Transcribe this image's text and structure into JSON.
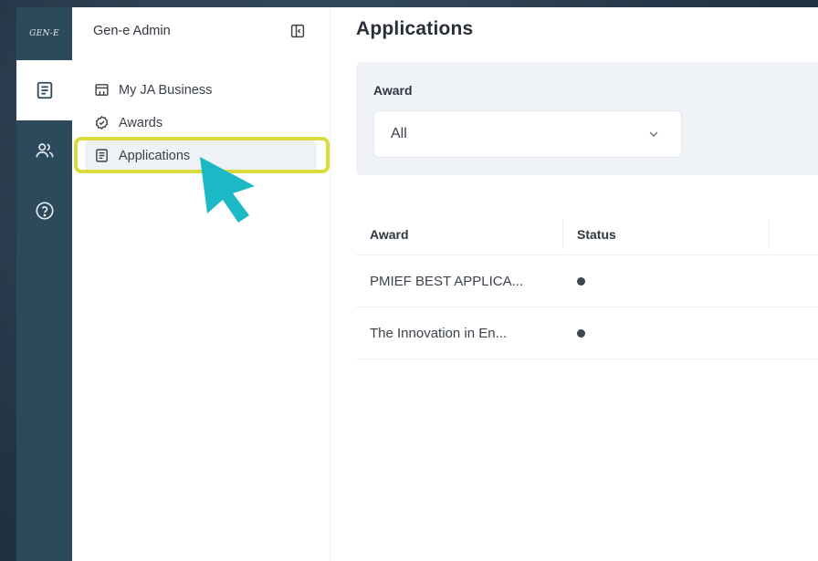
{
  "rail": {
    "logo": "GEN-E"
  },
  "sidebar": {
    "title": "Gen-e Admin",
    "items": [
      {
        "label": "My JA Business",
        "icon": "store-icon"
      },
      {
        "label": "Awards",
        "icon": "badge-check-icon"
      },
      {
        "label": "Applications",
        "icon": "document-list-icon",
        "active": true
      }
    ]
  },
  "main": {
    "title": "Applications",
    "filter": {
      "label": "Award",
      "selected": "All"
    },
    "table": {
      "columns": [
        "Award",
        "Status",
        ""
      ],
      "rows": [
        {
          "award": "PMIEF BEST APPLICA...",
          "status": "dot"
        },
        {
          "award": "The Innovation in En...",
          "status": "dot"
        }
      ]
    }
  },
  "colors": {
    "rail": "#2c4a5c",
    "highlight": "#d8db3b",
    "cursor": "#1bb8c6"
  }
}
